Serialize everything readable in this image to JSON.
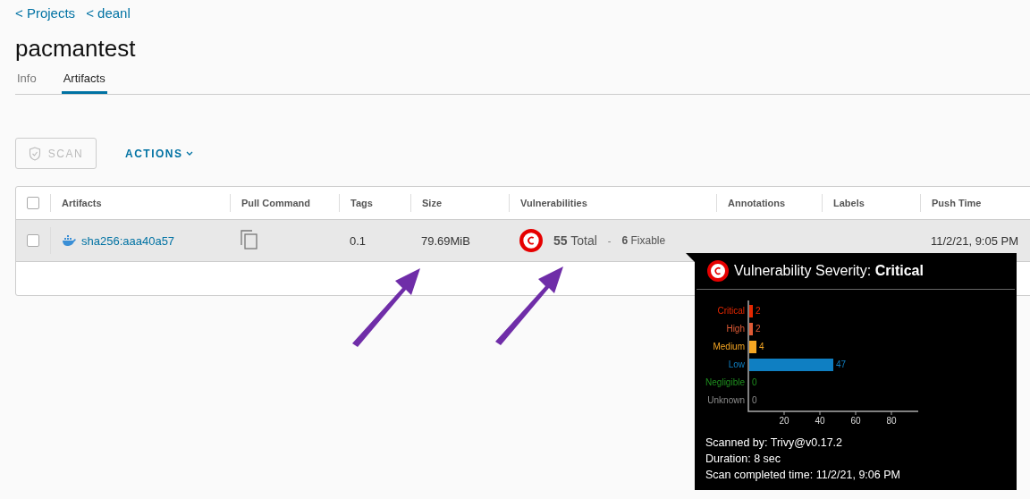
{
  "breadcrumbs": [
    "< Projects",
    "< deanl"
  ],
  "title": "pacmantest",
  "tabs": [
    {
      "label": "Info",
      "selected": false
    },
    {
      "label": "Artifacts",
      "selected": true
    }
  ],
  "toolbar": {
    "scan": {
      "label": "SCAN",
      "disabled": true
    },
    "actions": {
      "label": "ACTIONS"
    }
  },
  "table": {
    "columns": [
      "Artifacts",
      "Pull Command",
      "Tags",
      "Size",
      "Vulnerabilities",
      "Annotations",
      "Labels",
      "Push Time"
    ],
    "header_checked": false,
    "rows": [
      {
        "checked": false,
        "artifact": "sha256:aaa40a57",
        "tags": "0.1",
        "size": "79.69MiB",
        "kind": "critical",
        "total_count": "55",
        "total_label": "Total",
        "separator": "-",
        "fixable_count": "6",
        "fixable_label": "Fixable",
        "push_time": "11/2/21, 9:05 PM"
      }
    ]
  },
  "tooltip": {
    "title": "Vulnerability Severity:",
    "severity": "Critical",
    "chart_data": {
      "type": "bar",
      "orientation": "horizontal",
      "categories": [
        "Critical",
        "High",
        "Medium",
        "Low",
        "Negligible",
        "Unknown"
      ],
      "values": [
        2,
        2,
        4,
        47,
        0,
        0
      ],
      "colors": [
        "#e62700",
        "#e05a35",
        "#f5a623",
        "#0f7fc2",
        "#1e8e1e",
        "#8c8c8c"
      ],
      "xticks": [
        20,
        40,
        60,
        80
      ],
      "xlim": [
        0,
        95
      ],
      "data_labels": true
    },
    "details": [
      "Scanned by: Trivy@v0.17.2",
      "Duration: 8 sec",
      "Scan completed time: 11/2/21, 9:06 PM"
    ]
  },
  "callout_arrows": [
    {
      "kind": "arrow"
    },
    {
      "kind": "arrow"
    }
  ]
}
